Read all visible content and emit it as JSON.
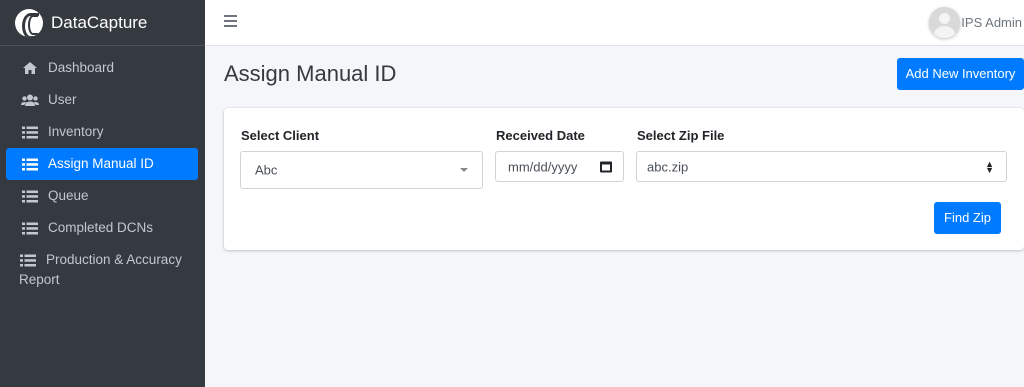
{
  "brand": {
    "name": "DataCapture"
  },
  "sidebar": {
    "items": [
      {
        "label": "Dashboard",
        "icon": "home-icon"
      },
      {
        "label": "User",
        "icon": "users-icon"
      },
      {
        "label": "Inventory",
        "icon": "list-icon"
      },
      {
        "label": "Assign Manual ID",
        "icon": "list-icon",
        "active": true
      },
      {
        "label": "Queue",
        "icon": "list-icon"
      },
      {
        "label": "Completed DCNs",
        "icon": "list-icon"
      },
      {
        "label": "Production & Accuracy",
        "label2": "Report",
        "icon": "list-icon"
      }
    ]
  },
  "header": {
    "user_name": "IPS Admin"
  },
  "main": {
    "title": "Assign Manual ID",
    "add_button": "Add New Inventory",
    "form": {
      "client_label": "Select Client",
      "client_value": "Abc",
      "date_label": "Received Date",
      "date_placeholder": "mm/dd/yyyy",
      "zip_label": "Select Zip File",
      "zip_value": "abc.zip",
      "find_button": "Find Zip"
    }
  },
  "colors": {
    "sidebar_bg": "#343a40",
    "primary": "#007bff",
    "content_bg": "#f4f6f9"
  }
}
